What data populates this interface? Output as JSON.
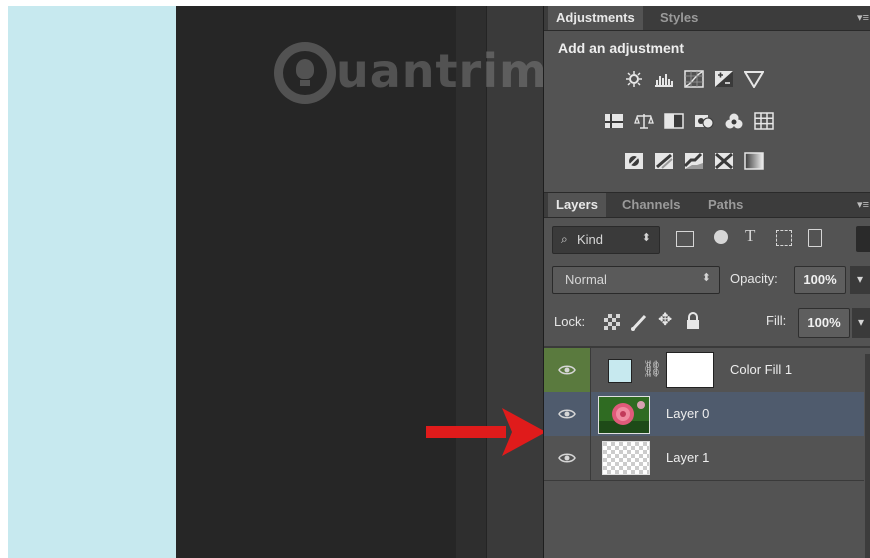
{
  "watermark": {
    "text": "uantrimang"
  },
  "adjustments_panel": {
    "tabs": [
      "Adjustments",
      "Styles"
    ],
    "heading": "Add an adjustment",
    "icons": [
      "brightness-contrast-icon",
      "levels-icon",
      "curves-icon",
      "exposure-icon",
      "vibrance-icon",
      "hue-saturation-icon",
      "color-balance-icon",
      "black-white-icon",
      "photo-filter-icon",
      "channel-mixer-icon",
      "color-lookup-icon",
      "invert-icon",
      "posterize-icon",
      "threshold-icon",
      "selective-color-icon",
      "gradient-map-icon"
    ]
  },
  "layers_panel": {
    "tabs": [
      "Layers",
      "Channels",
      "Paths"
    ],
    "filter": {
      "label": "Kind"
    },
    "blend_mode": "Normal",
    "opacity_label": "Opacity:",
    "opacity_value": "100%",
    "lock_label": "Lock:",
    "fill_label": "Fill:",
    "fill_value": "100%",
    "layers": [
      {
        "name": "Color Fill 1",
        "state": "highlighted-eye",
        "swatch_color": "#c7e9ef"
      },
      {
        "name": "Layer 0",
        "state": "selected"
      },
      {
        "name": "Layer 1",
        "state": "normal"
      }
    ]
  },
  "colors": {
    "canvas_fill": "#c7e9ef",
    "panel_bg": "#535353",
    "selected_layer": "#4f5b6d",
    "eye_highlight": "#5a7a3e",
    "arrow": "#e01b1b"
  }
}
